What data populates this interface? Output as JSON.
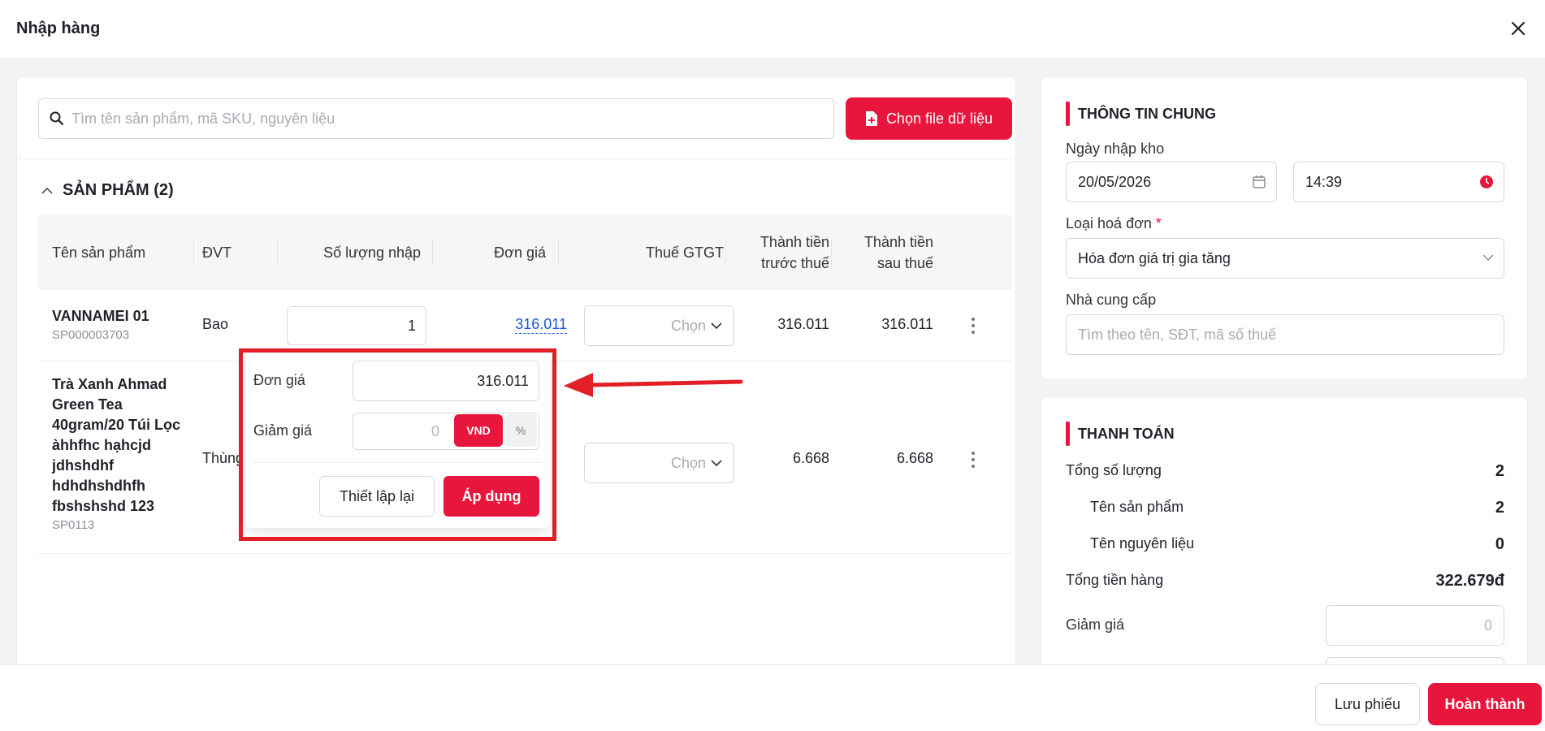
{
  "header": {
    "title": "Nhập hàng",
    "close_icon": "close-icon"
  },
  "search": {
    "placeholder": "Tìm tên sản phẩm, mã SKU, nguyên liệu"
  },
  "file_button": {
    "label": "Chọn file dữ liệu"
  },
  "products_section": {
    "title": "SẢN PHẨM (2)"
  },
  "table": {
    "columns": {
      "name": "Tên sản phẩm",
      "unit": "ĐVT",
      "qty": "Số lượng nhập",
      "price": "Đơn giá",
      "vat": "Thuế GTGT",
      "before_tax_1": "Thành tiền",
      "before_tax_2": "trước thuế",
      "after_tax_1": "Thành tiền",
      "after_tax_2": "sau thuế"
    },
    "rows": [
      {
        "name": "VANNAMEI 01",
        "sku": "SP000003703",
        "unit": "Bao",
        "qty": "1",
        "price": "316.011",
        "vat_placeholder": "Chọn",
        "before_tax": "316.011",
        "after_tax": "316.011"
      },
      {
        "name_lines": [
          "Trà Xanh Ahmad",
          "Green Tea",
          "40gram/20 Túi Lọc",
          "àhhfhc hạhcjd",
          "jdhshdhf",
          "hdhdhshdhfh",
          "fbshshshd 123"
        ],
        "sku": "SP0113",
        "unit": "Thùng",
        "vat_placeholder": "Chọn",
        "before_tax": "6.668",
        "after_tax": "6.668"
      }
    ]
  },
  "price_popover": {
    "price_label": "Đơn giá",
    "price_value": "316.011",
    "discount_label": "Giảm giá",
    "discount_value": "0",
    "unit_vnd": "VND",
    "unit_percent": "%",
    "reset_label": "Thiết lập lại",
    "apply_label": "Áp dụng"
  },
  "general_info": {
    "title": "THÔNG TIN CHUNG",
    "date_label": "Ngày nhập kho",
    "date_value": "20/05/2026",
    "time_value": "14:39",
    "invoice_label": "Loại hoá đơn",
    "invoice_required": "*",
    "invoice_value": "Hóa đơn giá trị gia tăng",
    "supplier_label": "Nhà cung cấp",
    "supplier_placeholder": "Tìm theo tên, SĐT, mã số thuế"
  },
  "payment": {
    "title": "THANH TOÁN",
    "total_qty_label": "Tổng số lượng",
    "total_qty_value": "2",
    "product_name_label": "Tên sản phẩm",
    "product_name_value": "2",
    "material_name_label": "Tên nguyên liệu",
    "material_name_value": "0",
    "total_goods_label": "Tổng tiền hàng",
    "total_goods_value": "322.679đ",
    "discount_label": "Giảm giá",
    "discount_value": "0"
  },
  "footer": {
    "save_label": "Lưu phiếu",
    "done_label": "Hoàn thành"
  },
  "colors": {
    "accent": "#e8163c",
    "link": "#1a56db",
    "annotation": "#e21f26"
  }
}
